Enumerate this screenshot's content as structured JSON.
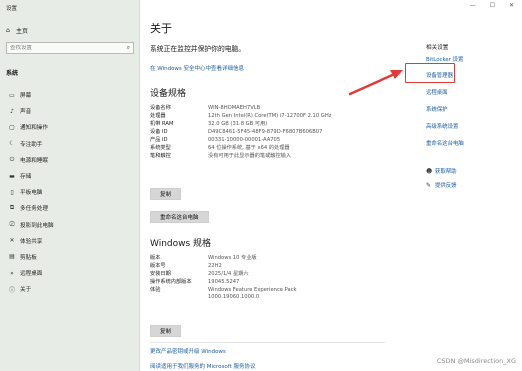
{
  "sidebar": {
    "app_title": "设置",
    "home_label": "主页",
    "search_placeholder": "查找设置",
    "section_label": "系统",
    "items": [
      {
        "label": "屏幕",
        "icon": "display-icon",
        "glyph": "▭"
      },
      {
        "label": "声音",
        "icon": "speaker-icon",
        "glyph": "♪"
      },
      {
        "label": "通知和操作",
        "icon": "notification-icon",
        "glyph": "▢"
      },
      {
        "label": "专注助手",
        "icon": "moon-icon",
        "glyph": "☾"
      },
      {
        "label": "电源和睡眠",
        "icon": "power-icon",
        "glyph": "⏻"
      },
      {
        "label": "存储",
        "icon": "storage-icon",
        "glyph": "▬"
      },
      {
        "label": "平板电脑",
        "icon": "tablet-icon",
        "glyph": "▯"
      },
      {
        "label": "多任务处理",
        "icon": "multitask-icon",
        "glyph": "⧉"
      },
      {
        "label": "投影到此电脑",
        "icon": "project-icon",
        "glyph": "⎚"
      },
      {
        "label": "体验共享",
        "icon": "share-icon",
        "glyph": "✕"
      },
      {
        "label": "剪贴板",
        "icon": "clipboard-icon",
        "glyph": "▤"
      },
      {
        "label": "远程桌面",
        "icon": "remote-desktop-icon",
        "glyph": "»"
      },
      {
        "label": "关于",
        "icon": "info-icon",
        "glyph": "ⓘ"
      }
    ]
  },
  "main": {
    "window_controls": {
      "minimize": "—",
      "maximize": "☐",
      "close": "✕"
    },
    "title": "关于",
    "monitor_text": "系统正在监控并保护你的电脑。",
    "security_link": "在 Windows 安全中心中查看详细信息",
    "device_specs": {
      "heading": "设备规格",
      "rows": [
        {
          "key": "设备名称",
          "value": "WIN-8HOMAEH7VLB"
        },
        {
          "key": "处理器",
          "value": "12th Gen Intel(R) Core(TM) i7-12700F   2.10 GHz"
        },
        {
          "key": "机带 RAM",
          "value": "32.0 GB (31.8 GB 可用)"
        },
        {
          "key": "设备 ID",
          "value": "D49C8461-5F45-48F9-879D-F6807B606B07"
        },
        {
          "key": "产品 ID",
          "value": "00331-10000-00001-AA705"
        },
        {
          "key": "系统类型",
          "value": "64 位操作系统, 基于 x64 的处理器"
        },
        {
          "key": "笔和触控",
          "value": "没有可用于此显示器的笔或触控输入"
        }
      ],
      "copy_button": "复制",
      "rename_button": "重命名这台电脑"
    },
    "windows_specs": {
      "heading": "Windows 规格",
      "rows": [
        {
          "key": "版本",
          "value": "Windows 10 专业版"
        },
        {
          "key": "版本号",
          "value": "22H2"
        },
        {
          "key": "安装日期",
          "value": "2025/1/4 星期六"
        },
        {
          "key": "操作系统内部版本",
          "value": "19045.5247"
        },
        {
          "key": "体验",
          "value": "Windows Feature Experience Pack"
        },
        {
          "key": "",
          "value": "1000.19060.1000.0"
        }
      ],
      "copy_button": "复制"
    },
    "bottom_links": [
      "更改产品密钥或升级 Windows",
      "阅读适用于我们服务的 Microsoft 服务协议"
    ]
  },
  "related": {
    "title": "相关设置",
    "links": [
      "BitLocker 设置",
      "设备管理器",
      "远程桌面",
      "系统保护",
      "高级系统设置",
      "重命名这台电脑"
    ],
    "help_links": [
      {
        "label": "获取帮助",
        "icon": "help-icon",
        "glyph": "☻"
      },
      {
        "label": "提供反馈",
        "icon": "feedback-icon",
        "glyph": "✎"
      }
    ]
  },
  "annotation": {
    "highlight_color": "#e53935",
    "highlight_target": "设备管理器"
  },
  "watermark": "CSDN @Misdirection_XG"
}
